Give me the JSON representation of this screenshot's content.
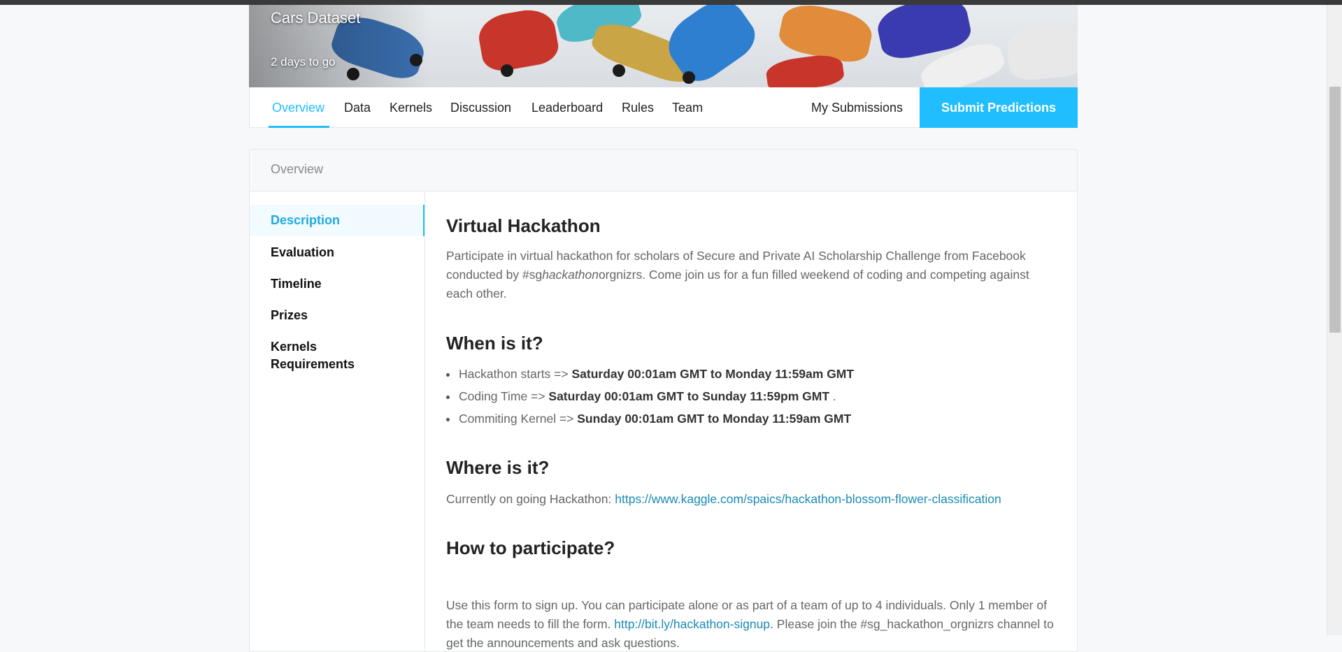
{
  "header": {
    "title": "Cars Dataset",
    "subtitle": "2 days to go"
  },
  "nav": {
    "tabs": [
      "Overview",
      "Data",
      "Kernels",
      "Discussion",
      "Leaderboard",
      "Rules",
      "Team"
    ],
    "active_tab": "Overview",
    "my_submissions": "My Submissions",
    "submit": "Submit Predictions"
  },
  "panel": {
    "title": "Overview",
    "sidebar": [
      "Description",
      "Evaluation",
      "Timeline",
      "Prizes",
      "Kernels Requirements"
    ],
    "active": "Description"
  },
  "content": {
    "heading1": "Virtual Hackathon",
    "intro_a": "Participate in virtual hackathon for scholars of Secure and Private AI Scholarship Challenge from Facebook conducted by #sg",
    "intro_italic": "hackathon",
    "intro_b": "orgnizrs. Come join us for a fun filled weekend of coding and competing against each other.",
    "heading2": "When is it?",
    "when": [
      {
        "label": "Hackathon starts => ",
        "value": "Saturday 00:01am GMT to Monday 11:59am GMT",
        "suffix": ""
      },
      {
        "label": "Coding Time => ",
        "value": "Saturday 00:01am GMT to Sunday 11:59pm GMT",
        "suffix": " ."
      },
      {
        "label": "Commiting Kernel => ",
        "value": "Sunday 00:01am GMT to Monday 11:59am GMT",
        "suffix": ""
      }
    ],
    "heading3": "Where is it?",
    "where_label": "Currently on going Hackathon: ",
    "where_link": "https://www.kaggle.com/spaics/hackathon-blossom-flower-classification",
    "heading4": "How to participate?",
    "participate_a": "Use this form to sign up. You can participate alone or as part of a team of up to 4 individuals. Only 1 member of the team needs to fill the form. ",
    "participate_link": "http://bit.ly/hackathon-signup",
    "participate_b": ". Please join the #sg_hackathon_orgnizrs channel to get the announcements and ask questions."
  },
  "colors": {
    "accent": "#20beff",
    "link": "#1b8bb5"
  }
}
